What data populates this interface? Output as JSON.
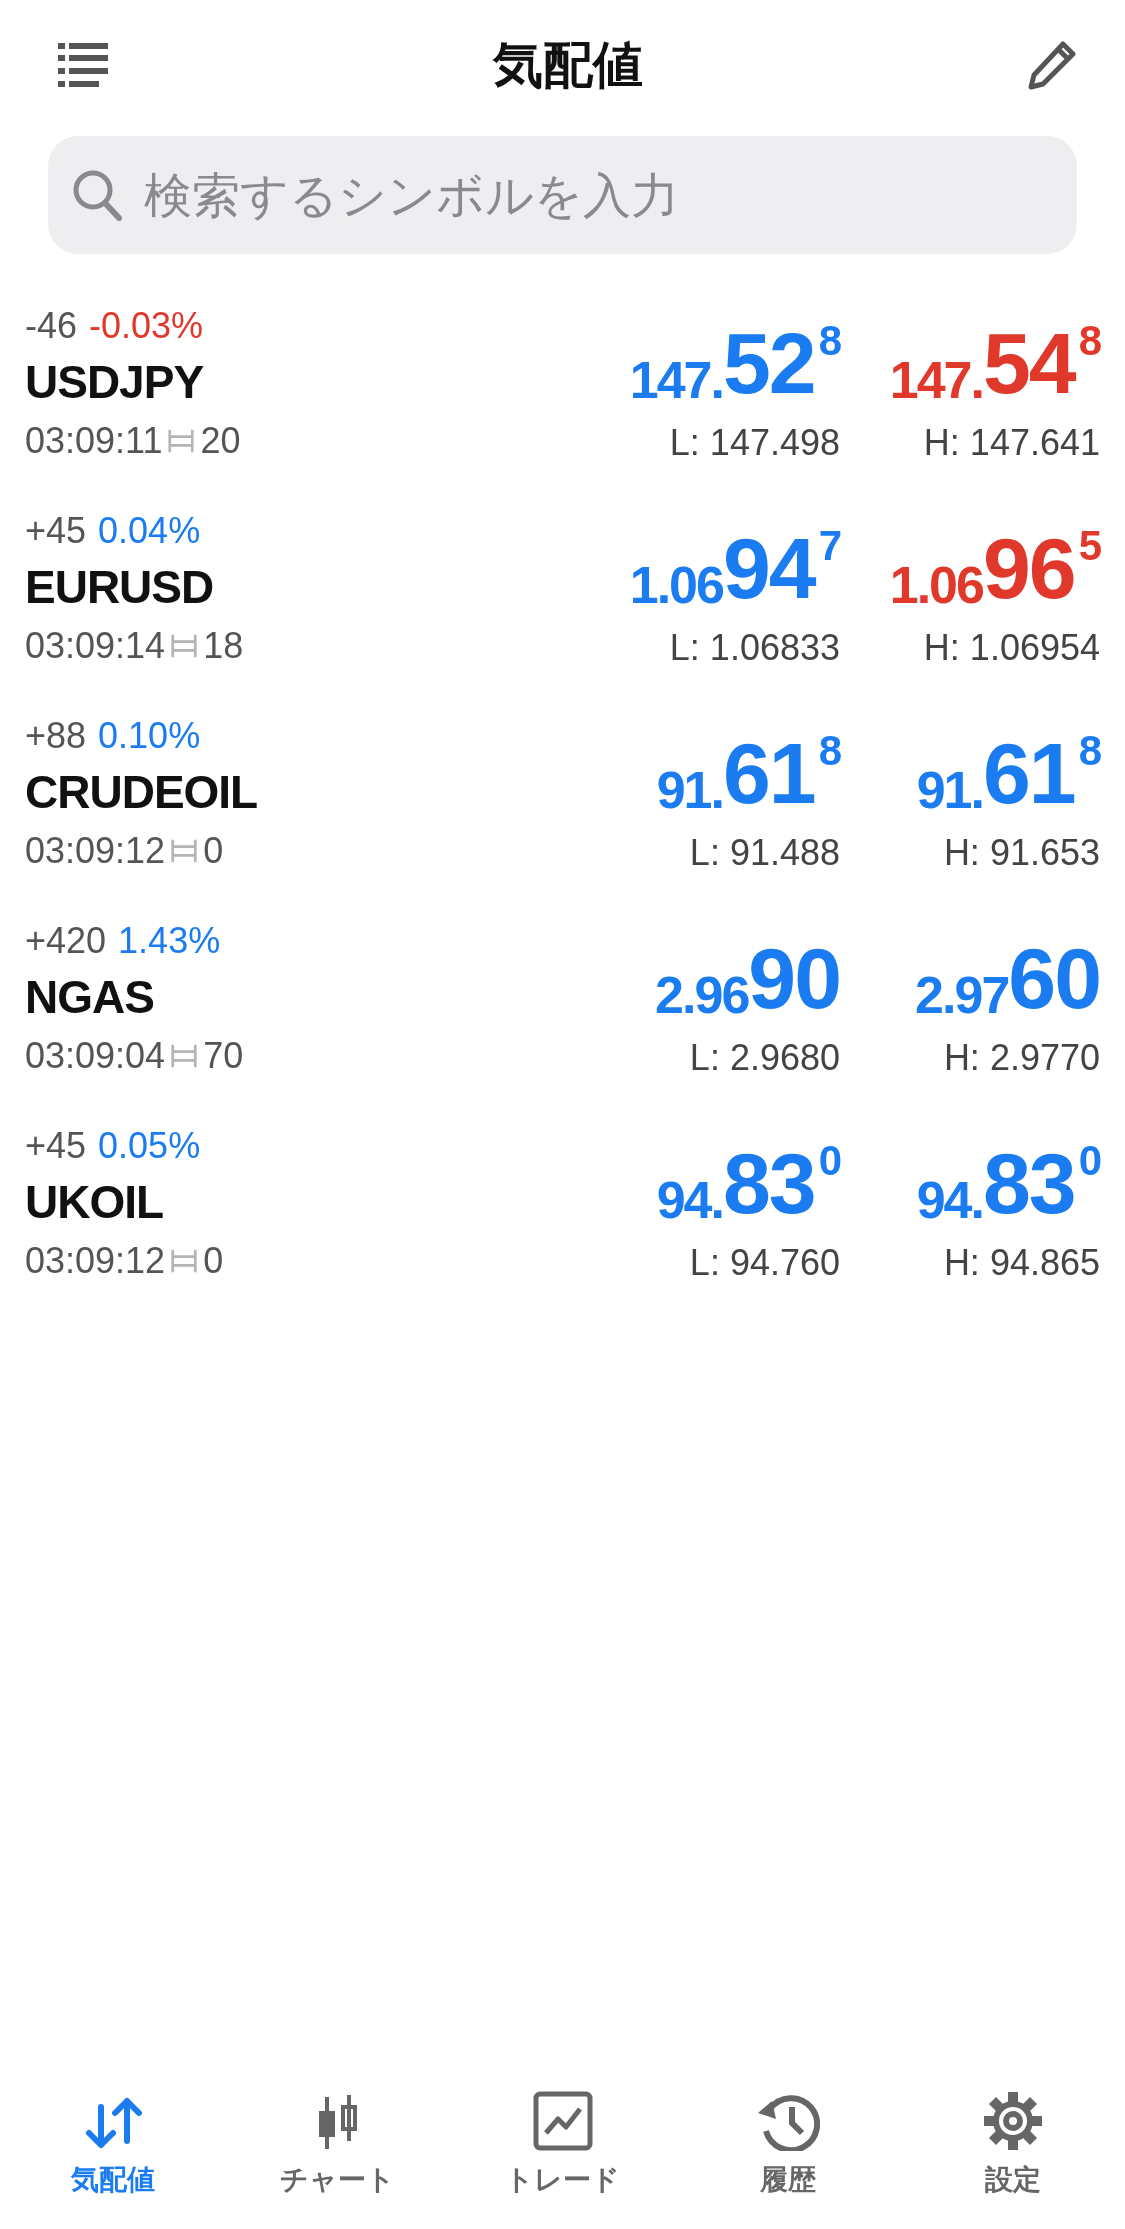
{
  "header": {
    "title": "気配値"
  },
  "search": {
    "placeholder": "検索するシンボルを入力"
  },
  "quotes": [
    {
      "symbol": "USDJPY",
      "change": {
        "points": "-46",
        "percent": "-0.03%",
        "color": "#e0392b"
      },
      "time": "03:09:11",
      "spread": "20",
      "bid": {
        "prefix": "147.",
        "big": "52",
        "sup": "8",
        "color": "#1a7cf0"
      },
      "ask": {
        "prefix": "147.",
        "big": "54",
        "sup": "8",
        "color": "#e0392b"
      },
      "low": "L: 147.498",
      "high": "H: 147.641"
    },
    {
      "symbol": "EURUSD",
      "change": {
        "points": "+45",
        "percent": "0.04%",
        "color": "#1a7cf0"
      },
      "time": "03:09:14",
      "spread": "18",
      "bid": {
        "prefix": "1.06",
        "big": "94",
        "sup": "7",
        "color": "#1a7cf0"
      },
      "ask": {
        "prefix": "1.06",
        "big": "96",
        "sup": "5",
        "color": "#e0392b"
      },
      "low": "L: 1.06833",
      "high": "H: 1.06954"
    },
    {
      "symbol": "CRUDEOIL",
      "change": {
        "points": "+88",
        "percent": "0.10%",
        "color": "#1a7cf0"
      },
      "time": "03:09:12",
      "spread": "0",
      "bid": {
        "prefix": "91.",
        "big": "61",
        "sup": "8",
        "color": "#1a7cf0"
      },
      "ask": {
        "prefix": "91.",
        "big": "61",
        "sup": "8",
        "color": "#1a7cf0"
      },
      "low": "L: 91.488",
      "high": "H: 91.653"
    },
    {
      "symbol": "NGAS",
      "change": {
        "points": "+420",
        "percent": "1.43%",
        "color": "#1a7cf0"
      },
      "time": "03:09:04",
      "spread": "70",
      "bid": {
        "prefix": "2.96",
        "big": "90",
        "color": "#1a7cf0"
      },
      "ask": {
        "prefix": "2.97",
        "big": "60",
        "color": "#1a7cf0"
      },
      "low": "L: 2.9680",
      "high": "H: 2.9770"
    },
    {
      "symbol": "UKOIL",
      "change": {
        "points": "+45",
        "percent": "0.05%",
        "color": "#1a7cf0"
      },
      "time": "03:09:12",
      "spread": "0",
      "bid": {
        "prefix": "94.",
        "big": "83",
        "sup": "0",
        "color": "#1a7cf0"
      },
      "ask": {
        "prefix": "94.",
        "big": "83",
        "sup": "0",
        "color": "#1a7cf0"
      },
      "low": "L: 94.760",
      "high": "H: 94.865"
    }
  ],
  "tabs": [
    {
      "kind": "quotes",
      "label": "気配値",
      "selected": true
    },
    {
      "kind": "chart",
      "label": "チャート",
      "selected": false
    },
    {
      "kind": "trade",
      "label": "トレード",
      "selected": false
    },
    {
      "kind": "history",
      "label": "履歴",
      "selected": false
    },
    {
      "kind": "settings",
      "label": "設定",
      "selected": false
    }
  ]
}
